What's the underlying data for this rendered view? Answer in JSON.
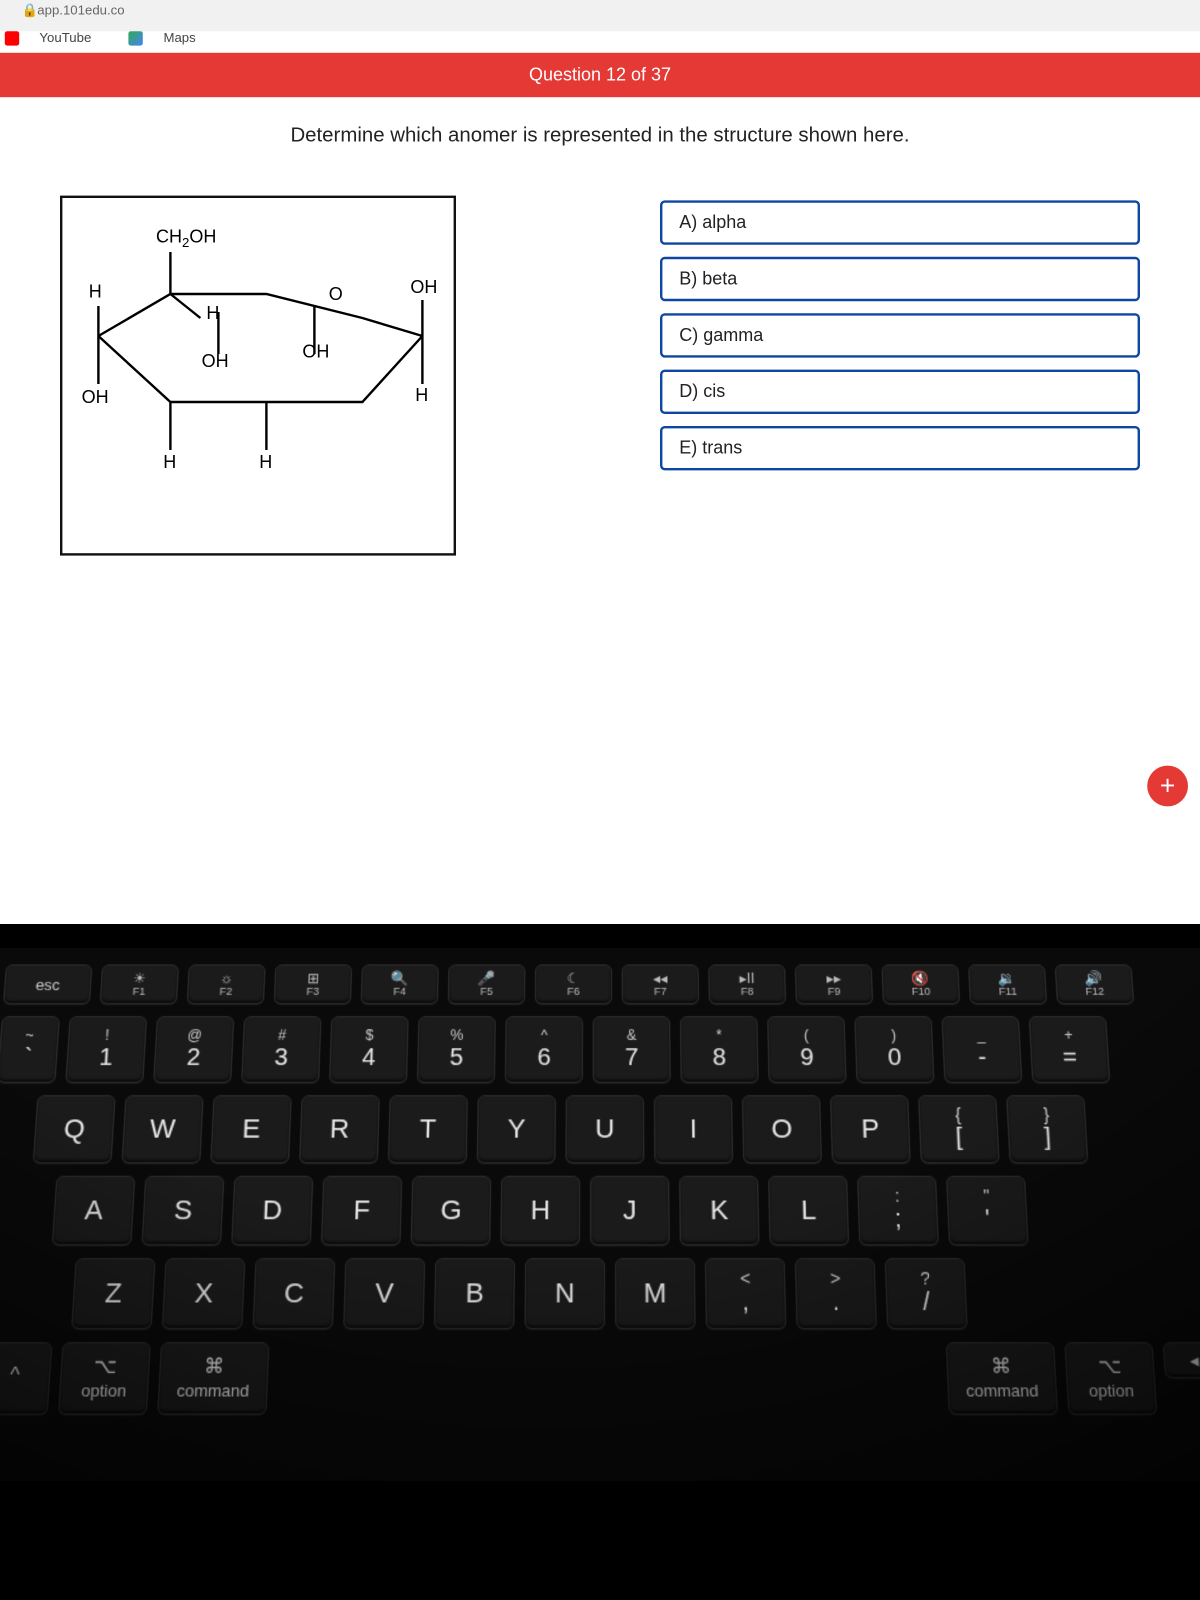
{
  "browser": {
    "url": "app.101edu.co",
    "bookmarks": [
      "YouTube",
      "Maps"
    ]
  },
  "quiz": {
    "header": "Question 12 of 37",
    "prompt": "Determine which anomer is represented in the structure shown here.",
    "choices": [
      "A) alpha",
      "B) beta",
      "C) gamma",
      "D) cis",
      "E) trans"
    ],
    "structure_labels": {
      "top": "CH₂OH",
      "ring_o": "O",
      "left_up": "H",
      "left_down": "OH",
      "c2_up": "H",
      "c2_down": "OH",
      "c3_down": "H",
      "c4_up": "OH",
      "c4_down": "H",
      "right_up": "OH",
      "right_down": "H"
    },
    "fab": "+"
  },
  "keyboard": {
    "frow": [
      {
        "icon": "",
        "label": "esc"
      },
      {
        "icon": "☀",
        "label": "F1"
      },
      {
        "icon": "☼",
        "label": "F2"
      },
      {
        "icon": "⊞",
        "label": "F3"
      },
      {
        "icon": "🔍",
        "label": "F4"
      },
      {
        "icon": "🎤",
        "label": "F5"
      },
      {
        "icon": "☾",
        "label": "F6"
      },
      {
        "icon": "◂◂",
        "label": "F7"
      },
      {
        "icon": "▸II",
        "label": "F8"
      },
      {
        "icon": "▸▸",
        "label": "F9"
      },
      {
        "icon": "🔇",
        "label": "F10"
      },
      {
        "icon": "🔉",
        "label": "F11"
      },
      {
        "icon": "🔊",
        "label": "F12"
      }
    ],
    "row1": [
      {
        "top": "~",
        "bot": "`"
      },
      {
        "top": "!",
        "bot": "1"
      },
      {
        "top": "@",
        "bot": "2"
      },
      {
        "top": "#",
        "bot": "3"
      },
      {
        "top": "$",
        "bot": "4"
      },
      {
        "top": "%",
        "bot": "5"
      },
      {
        "top": "^",
        "bot": "6"
      },
      {
        "top": "&",
        "bot": "7"
      },
      {
        "top": "*",
        "bot": "8"
      },
      {
        "top": "(",
        "bot": "9"
      },
      {
        "top": ")",
        "bot": "0"
      },
      {
        "top": "_",
        "bot": "-"
      },
      {
        "top": "+",
        "bot": "="
      }
    ],
    "row2": [
      "Q",
      "W",
      "E",
      "R",
      "T",
      "Y",
      "U",
      "I",
      "O",
      "P"
    ],
    "row2b": [
      {
        "top": "{",
        "bot": "["
      },
      {
        "top": "}",
        "bot": "]"
      }
    ],
    "row3": [
      "A",
      "S",
      "D",
      "F",
      "G",
      "H",
      "J",
      "K",
      "L"
    ],
    "row3b": [
      {
        "top": ":",
        "bot": ";"
      },
      {
        "top": "\"",
        "bot": "'"
      }
    ],
    "row4": [
      "Z",
      "X",
      "C",
      "V",
      "B",
      "N",
      "M"
    ],
    "row4b": [
      {
        "top": "<",
        "bot": ","
      },
      {
        "top": ">",
        "bot": "."
      },
      {
        "top": "?",
        "bot": "/"
      }
    ],
    "mods": {
      "ctrl": "^",
      "option_sym": "⌥",
      "option": "option",
      "command_sym": "⌘",
      "command": "command",
      "arrow": "◂"
    }
  }
}
